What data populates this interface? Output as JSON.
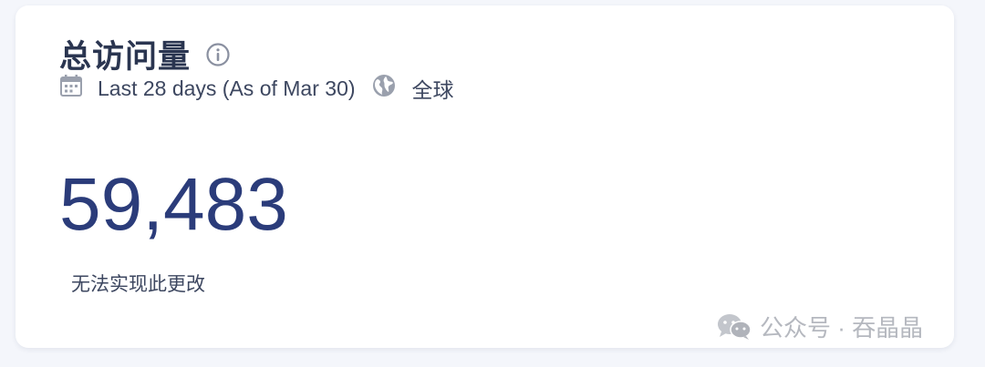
{
  "card": {
    "title": "总访问量",
    "date_range": "Last 28 days (As of Mar 30)",
    "region": "全球",
    "metric_value": "59,483",
    "note": "无法实现此更改"
  },
  "icons": {
    "info": "info-icon",
    "calendar": "calendar-icon",
    "globe": "globe-icon"
  },
  "watermark": {
    "text": "公众号 · 吞晶晶"
  },
  "colors": {
    "metric": "#2b3c7a",
    "title": "#2a3550",
    "background": "#f4f6fb"
  }
}
